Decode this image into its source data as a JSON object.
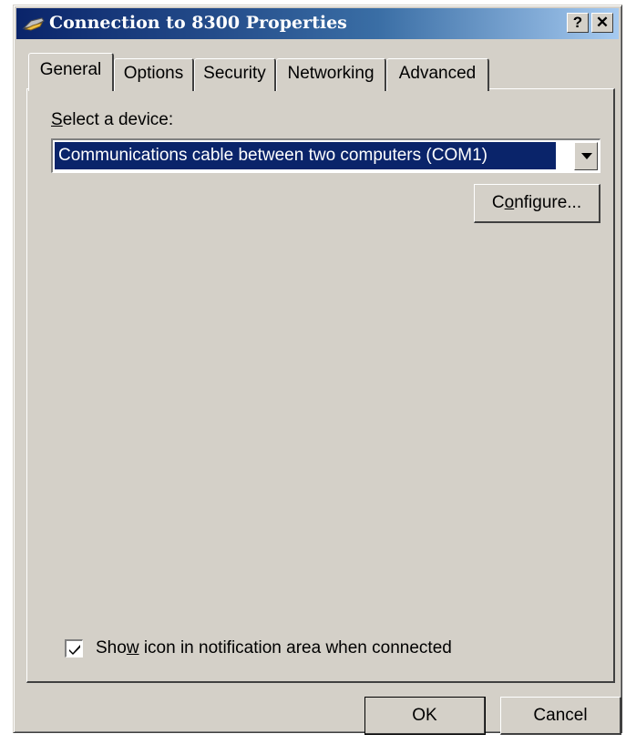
{
  "window": {
    "title": "Connection to 8300 Properties",
    "help_button": "?",
    "close_button": "✕",
    "title_icon": "modem-connection-icon"
  },
  "tabs": [
    {
      "label": "General",
      "active": true
    },
    {
      "label": "Options",
      "active": false
    },
    {
      "label": "Security",
      "active": false
    },
    {
      "label": "Networking",
      "active": false
    },
    {
      "label": "Advanced",
      "active": false
    }
  ],
  "general": {
    "device_label_access_key": "S",
    "device_label_rest": "elect a device:",
    "device_selected": "Communications cable between two computers (COM1)",
    "configure_pre": "C",
    "configure_access_key": "o",
    "configure_post": "nfigure...",
    "show_icon_checked": true,
    "show_icon_pre": "Sho",
    "show_icon_access_key": "w",
    "show_icon_post": " icon in notification area when connected"
  },
  "buttons": {
    "ok": "OK",
    "cancel": "Cancel"
  },
  "colors": {
    "dialog_face": "#d4d0c8",
    "titlebar_start": "#0a246a",
    "titlebar_end": "#a6caf0",
    "selection": "#0a246a"
  }
}
